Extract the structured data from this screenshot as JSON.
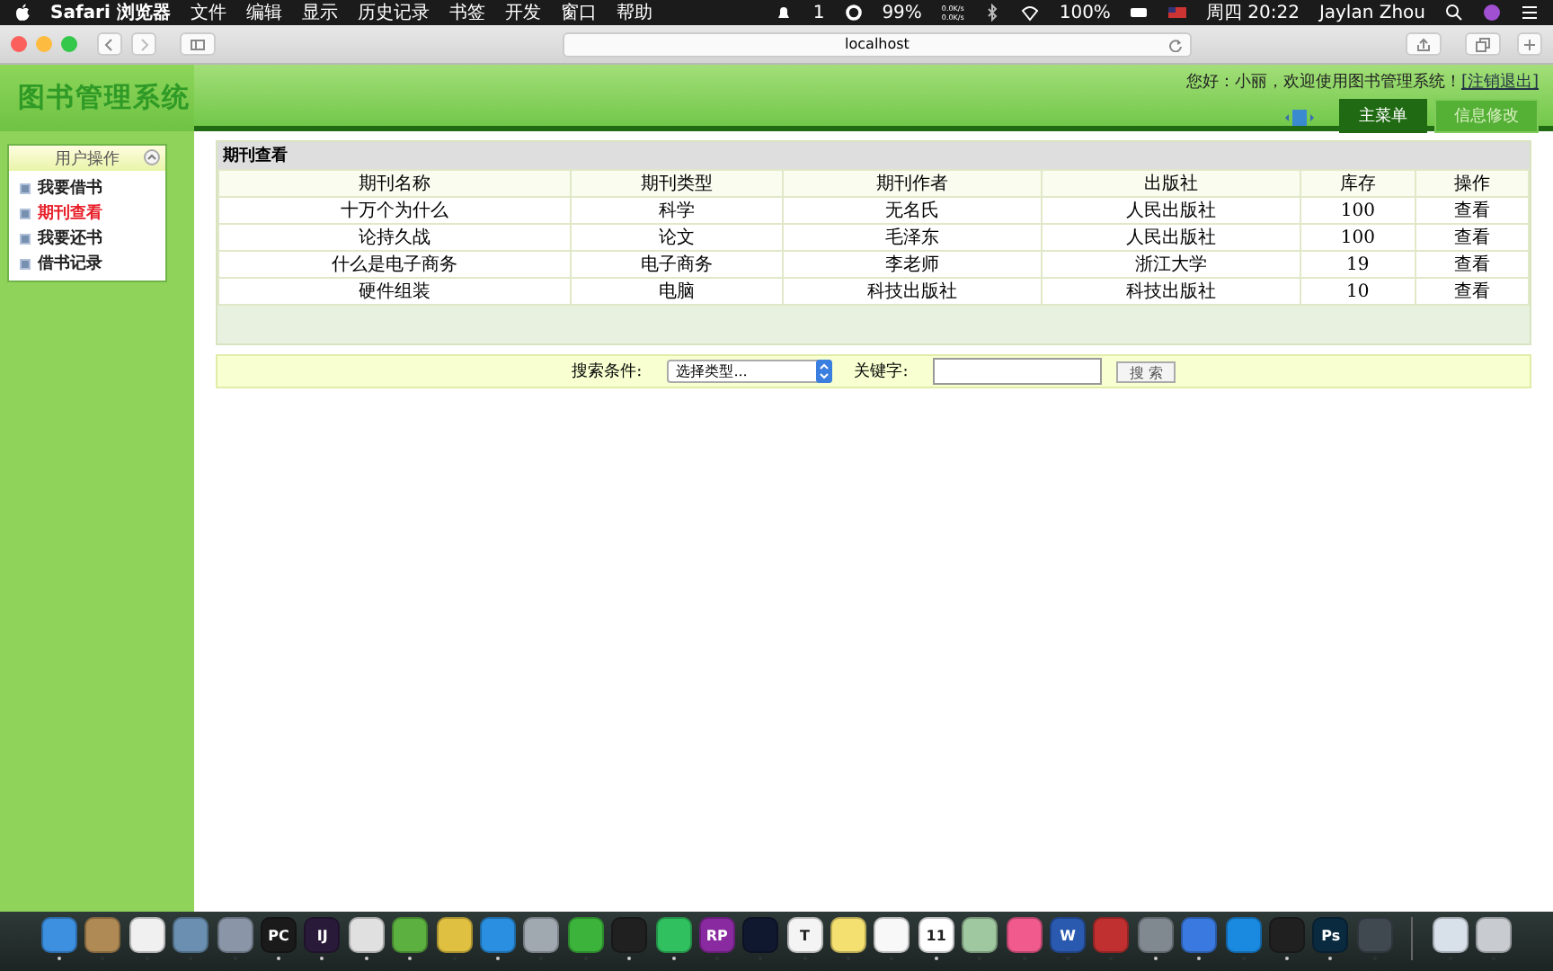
{
  "menubar": {
    "app": "Safari 浏览器",
    "menus": [
      "文件",
      "编辑",
      "显示",
      "历史记录",
      "书签",
      "开发",
      "窗口",
      "帮助"
    ],
    "status": {
      "notifications": "1",
      "cpu": "99%",
      "net_up": "0.0K/s",
      "net_down": "0.0K/s",
      "battery": "100%",
      "clock": "周四 20:22",
      "user": "Jaylan Zhou"
    }
  },
  "browser": {
    "address": "localhost"
  },
  "app": {
    "logo": "图书管理系统",
    "greeting": "您好：小丽，欢迎使用图书管理系统！",
    "logout": "[注销退出]",
    "tabs": [
      {
        "label": "主菜单",
        "selected": true
      },
      {
        "label": "信息修改",
        "selected": false
      }
    ]
  },
  "sidebar": {
    "title": "用户操作",
    "items": [
      {
        "label": "我要借书",
        "selected": false
      },
      {
        "label": "期刊查看",
        "selected": true
      },
      {
        "label": "我要还书",
        "selected": false
      },
      {
        "label": "借书记录",
        "selected": false
      }
    ]
  },
  "table": {
    "title": "期刊查看",
    "columns": [
      "期刊名称",
      "期刊类型",
      "期刊作者",
      "出版社",
      "库存",
      "操作"
    ],
    "rows": [
      [
        "十万个为什么",
        "科学",
        "无名氏",
        "人民出版社",
        "100",
        "查看"
      ],
      [
        "论持久战",
        "论文",
        "毛泽东",
        "人民出版社",
        "100",
        "查看"
      ],
      [
        "什么是电子商务",
        "电子商务",
        "李老师",
        "浙江大学",
        "19",
        "查看"
      ],
      [
        "硬件组装",
        "电脑",
        "科技出版社",
        "科技出版社",
        "10",
        "查看"
      ]
    ]
  },
  "search": {
    "label": "搜索条件:",
    "select": "选择类型...",
    "keyword_label": "关键字:",
    "button": "搜 索"
  },
  "dock": [
    {
      "color": "#3d8fe0",
      "running": true
    },
    {
      "color": "#b08a55",
      "running": false
    },
    {
      "color": "#f0f0f0",
      "running": false
    },
    {
      "color": "#6a8fb0",
      "running": false
    },
    {
      "color": "#8a96a8",
      "running": false
    },
    {
      "color": "#1a1a1a",
      "glyph": "PC",
      "running": true
    },
    {
      "color": "#2a1a3a",
      "glyph": "IJ",
      "running": true
    },
    {
      "color": "#e0e0e0",
      "running": true
    },
    {
      "color": "#5cb040",
      "running": true
    },
    {
      "color": "#e0c040",
      "running": false
    },
    {
      "color": "#2a8fe0",
      "running": true
    },
    {
      "color": "#a0a8b0",
      "running": false
    },
    {
      "color": "#3cb43c",
      "running": false
    },
    {
      "color": "#202020",
      "running": true
    },
    {
      "color": "#30c060",
      "running": true
    },
    {
      "color": "#8a2aa0",
      "glyph": "RP",
      "running": false
    },
    {
      "color": "#101830",
      "running": false
    },
    {
      "color": "#f4f4f4",
      "glyph": "T",
      "running": false
    },
    {
      "color": "#f4e070",
      "running": false
    },
    {
      "color": "#f8f8f8",
      "running": false
    },
    {
      "color": "#ffffff",
      "glyph": "11",
      "running": true
    },
    {
      "color": "#a0c8a0",
      "running": false
    },
    {
      "color": "#f05a8c",
      "running": false
    },
    {
      "color": "#2a5ab0",
      "glyph": "W",
      "running": false
    },
    {
      "color": "#c03030",
      "running": false
    },
    {
      "color": "#808890",
      "running": true
    },
    {
      "color": "#3a7ae0",
      "running": true
    },
    {
      "color": "#1a8ae0",
      "running": false
    },
    {
      "color": "#202020",
      "running": true
    },
    {
      "color": "#0a2a40",
      "glyph": "Ps",
      "running": true
    },
    {
      "color": "#404850",
      "running": false
    },
    {
      "color": "#d8e0ea",
      "running": false
    },
    {
      "color": "#c8ccd0",
      "running": false
    }
  ]
}
